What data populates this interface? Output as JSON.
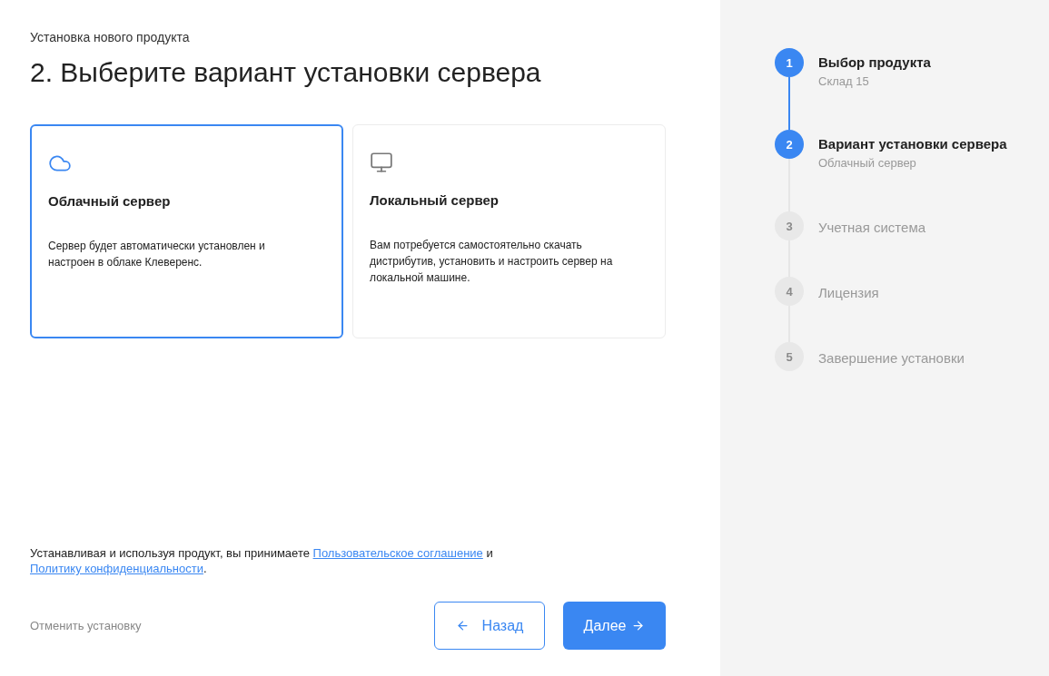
{
  "breadcrumb": "Установка нового продукта",
  "title": "2. Выберите вариант установки сервера",
  "options": [
    {
      "kind": "cloud",
      "title": "Облачный сервер",
      "description": "Сервер будет автоматически установлен и настроен в облаке Клеверенс.",
      "selected": true
    },
    {
      "kind": "local",
      "title": "Локальный сервер",
      "description": "Вам потребуется самостоятельно скачать дистрибутив, установить и настроить сервер на локальной машине.",
      "selected": false
    }
  ],
  "consent": {
    "text": "Устанавливая и используя продукт, вы принимаете",
    "link_1": "Пользовательское соглашение",
    "joiner": "и",
    "link_2": "Политику конфиденциальности",
    "end": "."
  },
  "cancel": "Отменить установку",
  "back_button": "Назад",
  "next_button": "Далее",
  "steps": [
    {
      "number": "1",
      "title": "Выбор продукта",
      "subtitle": "Склад 15",
      "active": true
    },
    {
      "number": "2",
      "title": "Вариант установки сервера",
      "subtitle": "Облачный сервер",
      "active": true
    },
    {
      "number": "3",
      "title": "Учетная система",
      "active": false
    },
    {
      "number": "4",
      "title": "Лицензия",
      "active": false
    },
    {
      "number": "5",
      "title": "Завершение установки",
      "active": false
    }
  ]
}
